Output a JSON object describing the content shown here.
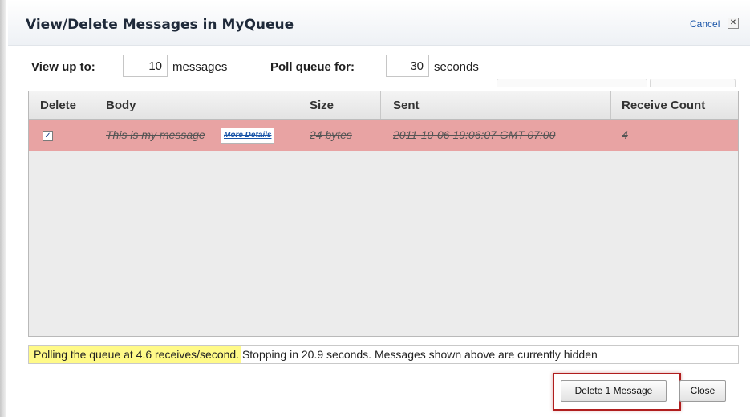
{
  "dialog": {
    "title": "View/Delete Messages in MyQueue",
    "cancel_label": "Cancel",
    "cancel_icon": "close-icon",
    "close_glyph": "✕"
  },
  "options": {
    "view_up_to_label": "View up to:",
    "view_up_to_value": "10",
    "messages_suffix": "messages",
    "poll_label": "Poll queue for:",
    "poll_value": "30",
    "seconds_suffix": "seconds"
  },
  "table": {
    "columns": [
      "Delete",
      "Body",
      "Size",
      "Sent",
      "Receive Count"
    ],
    "rows": [
      {
        "checked": true,
        "check_glyph": "✓",
        "body": "This is my message",
        "more_details_label": "More Details",
        "size": "24 bytes",
        "sent": "2011-10-06 19:06:07 GMT-07:00",
        "receive_count": "4",
        "row_color": "#e8a3a3"
      }
    ]
  },
  "status": {
    "text": "Polling the queue at 4.6 receives/second. Stopping in 20.9 seconds. Messages shown above are currently hidden",
    "progress_fraction": 0.3,
    "progress_color": "#fffa88"
  },
  "actions": {
    "delete_label": "Delete 1 Message",
    "close_label": "Close",
    "highlight_color": "#b01e1e"
  }
}
